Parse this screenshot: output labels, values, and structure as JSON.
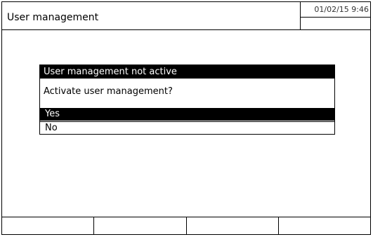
{
  "header": {
    "title": "User management",
    "datetime": "01/02/15 9:46"
  },
  "dialog": {
    "title": "User management not active",
    "question": "Activate user management?",
    "options": [
      {
        "label": "Yes",
        "selected": true
      },
      {
        "label": "No",
        "selected": false
      }
    ]
  },
  "softkeys": [
    {
      "label": ""
    },
    {
      "label": ""
    },
    {
      "label": ""
    },
    {
      "label": ""
    }
  ]
}
